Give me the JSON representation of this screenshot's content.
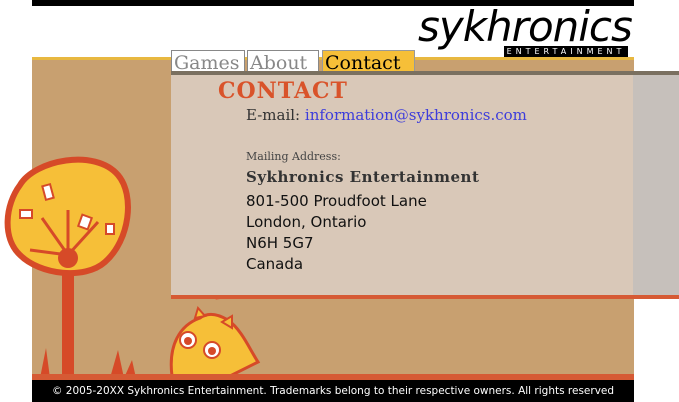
{
  "logo": {
    "word": "sykhronics",
    "sub": "ENTERTAINMENT"
  },
  "tabs": [
    {
      "label": "Games"
    },
    {
      "label": "About"
    },
    {
      "label": "Contact",
      "active": true
    }
  ],
  "contact": {
    "title": "CONTACT",
    "email_label": "E-mail:",
    "email": "information@sykhronics.com",
    "mailing_label": "Mailing Address:",
    "company": "Sykhronics Entertainment",
    "address": [
      "801-500 Proudfoot Lane",
      "London, Ontario",
      "N6H 5G7",
      "Canada"
    ]
  },
  "footer": {
    "text": "© 2005-20XX Sykhronics Entertainment.  Trademarks belong to their respective owners.  All rights reserved"
  },
  "colors": {
    "accent_orange": "#d9532a",
    "tab_active": "#f6bf38",
    "link": "#3d3ddb",
    "background_tan": "#c8a070"
  }
}
